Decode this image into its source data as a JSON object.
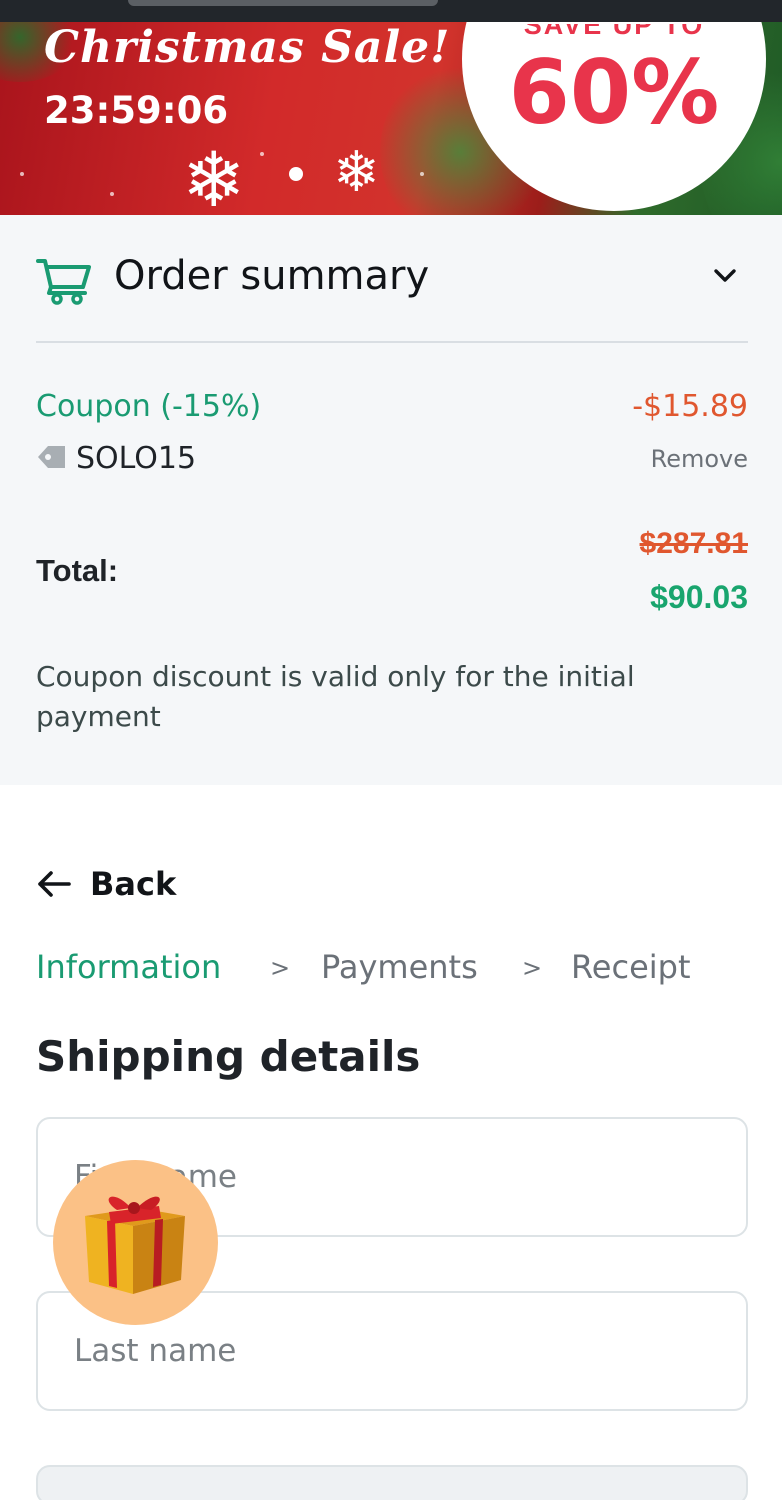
{
  "banner": {
    "title": "Christmas Sale!",
    "countdown": "23:59:06",
    "promo_top": "SAVE UP TO",
    "promo_big": "60%"
  },
  "order_summary": {
    "title": "Order summary",
    "icon": "cart-icon",
    "toggle_icon": "chevron-down-icon",
    "coupon": {
      "label": "Coupon (-15%)",
      "amount": "-$15.89",
      "code": "SOLO15",
      "remove_label": "Remove"
    },
    "total": {
      "label": "Total:",
      "original": "$287.81",
      "discounted": "$90.03"
    },
    "note": "Coupon discount is valid only for the initial payment"
  },
  "navigation": {
    "back_label": "Back",
    "steps": [
      {
        "label": "Information",
        "active": true
      },
      {
        "label": "Payments",
        "active": false
      },
      {
        "label": "Receipt",
        "active": false
      }
    ],
    "separator": ">"
  },
  "shipping": {
    "title": "Shipping details",
    "first_name_placeholder": "First name",
    "last_name_placeholder": "Last name"
  },
  "colors": {
    "accent_green": "#1a9b72",
    "total_green": "#19a56e",
    "discount_red": "#e0572f",
    "promo_red": "#e8344b",
    "gift_bubble": "#fbc186"
  }
}
